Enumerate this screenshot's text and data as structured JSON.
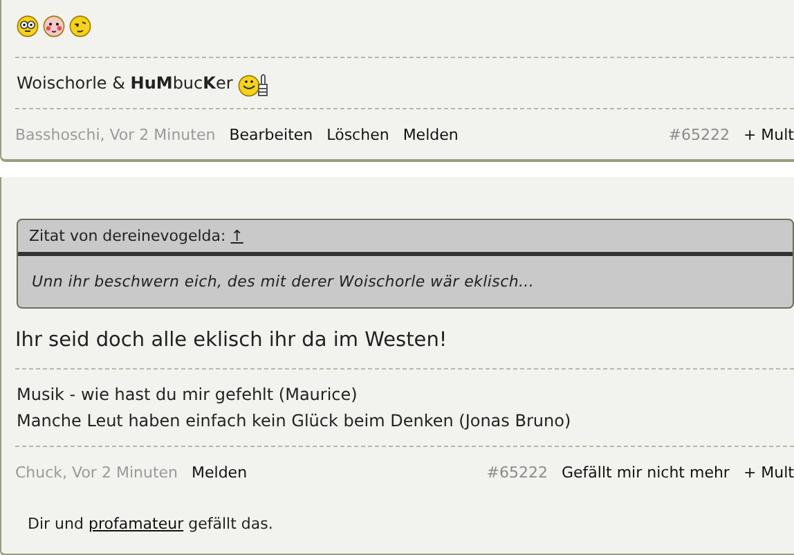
{
  "posts": [
    {
      "content": [
        {
          "kind": "smileys"
        }
      ],
      "signature": [
        {
          "text": "Woischorle & **HuM**buc**K**er",
          "thumb_smiley": true
        }
      ],
      "footer": {
        "author": "Basshoschi, Vor 2 Minuten",
        "actions": [
          "Bearbeiten",
          "Löschen",
          "Melden"
        ],
        "number": "#65222",
        "right_actions": [
          "+ Mult"
        ]
      }
    },
    {
      "quote": {
        "header": "Zitat von dereinevogelda:",
        "link": "↑",
        "text": "Unn ihr beschwern eich, des mit derer Woischorle wär eklisch..."
      },
      "content": [
        {
          "kind": "text",
          "text": "Ihr seid doch alle eklisch ihr da im Westen!"
        }
      ],
      "signature": [
        {
          "text": "Musik - wie hast du mir gefehlt (Maurice)",
          "thumb_smiley": false
        },
        {
          "text": "Manche Leut haben einfach kein Glück beim Denken (Jonas Bruno)",
          "thumb_smiley": false
        }
      ],
      "footer": {
        "author": "Chuck, Vor 2 Minuten",
        "actions": [
          "Melden"
        ],
        "number": "#65222",
        "right_actions": [
          "Gefällt mir nicht mehr",
          "+ Mult"
        ]
      },
      "likes": {
        "before": "Dir und",
        "link": "profamateur",
        "after": "gefällt das."
      }
    }
  ]
}
